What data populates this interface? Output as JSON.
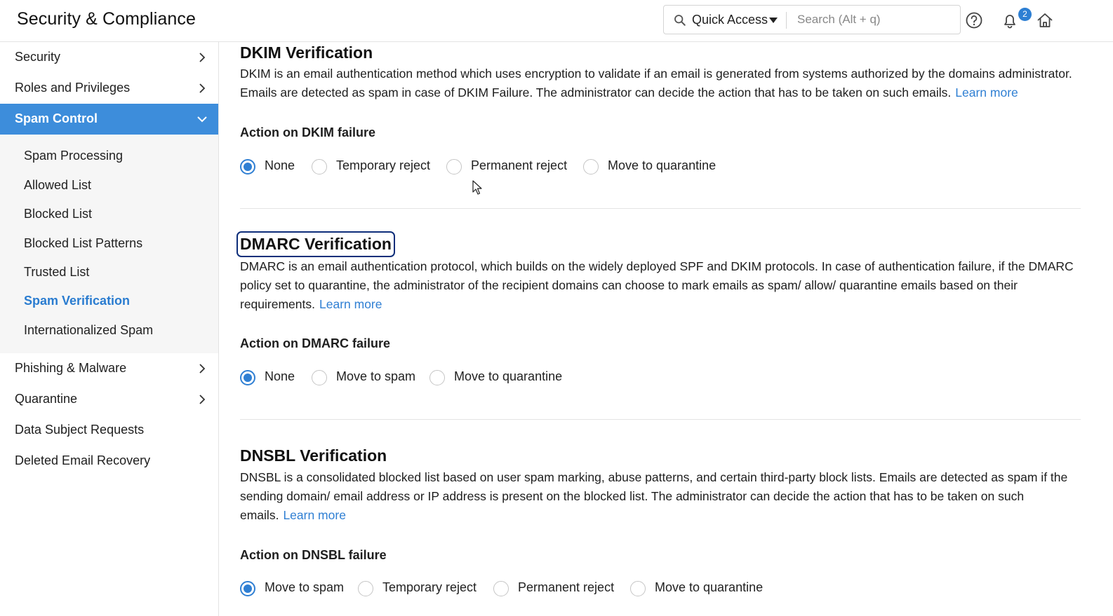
{
  "header": {
    "title": "Security & Compliance",
    "quick_access": "Quick Access",
    "search_placeholder": "Search (Alt + q)",
    "notification_count": "2"
  },
  "sidebar": {
    "items": [
      {
        "label": "Security",
        "chevron": "right"
      },
      {
        "label": "Roles and Privileges",
        "chevron": "right"
      },
      {
        "label": "Spam Control",
        "chevron": "down",
        "active": true
      },
      {
        "label": "Phishing & Malware",
        "chevron": "right"
      },
      {
        "label": "Quarantine",
        "chevron": "right"
      },
      {
        "label": "Data Subject Requests"
      },
      {
        "label": "Deleted Email Recovery"
      }
    ],
    "spam_sub_items": [
      "Spam Processing",
      "Allowed List",
      "Blocked List",
      "Blocked List Patterns",
      "Trusted List",
      "Spam Verification",
      "Internationalized Spam"
    ],
    "active_sub_item": "Spam Verification"
  },
  "sections": [
    {
      "title": "DKIM Verification",
      "description": "DKIM is an email authentication method which uses encryption to validate if an email is generated from systems authorized by the domains administrator. Emails are detected as spam in case of DKIM Failure. The administrator can decide the action that has to be taken on such emails.",
      "learn_more": "Learn more",
      "action_label": "Action on DKIM failure",
      "options": [
        "None",
        "Temporary reject",
        "Permanent reject",
        "Move to quarantine"
      ],
      "selected": "None"
    },
    {
      "title": "DMARC Verification",
      "description": "DMARC is an email authentication protocol, which builds on the widely deployed SPF and DKIM protocols. In case of authentication failure, if the DMARC policy set to quarantine, the administrator of the recipient domains can choose to mark emails as spam/ allow/ quarantine emails based on their requirements.",
      "learn_more": "Learn more",
      "action_label": "Action on DMARC failure",
      "options": [
        "None",
        "Move to spam",
        "Move to quarantine"
      ],
      "selected": "None"
    },
    {
      "title": "DNSBL Verification",
      "description": "DNSBL is a consolidated blocked list based on user spam marking, abuse patterns, and certain third-party block lists. Emails are detected as spam if the sending domain/ email address or IP address is present on the blocked list. The administrator can decide the action that has to be taken on such emails.",
      "learn_more": "Learn more",
      "action_label": "Action on DNSBL failure",
      "options": [
        "Move to spam",
        "Temporary reject",
        "Permanent reject",
        "Move to quarantine"
      ],
      "selected": "Move to spam"
    }
  ],
  "colors": {
    "accent": "#2f7fd3",
    "sidebar_active_bg": "#3d8ddb",
    "focus_outline": "#0e2e7a"
  },
  "icons": {
    "search": "search-icon",
    "help": "help-circle-icon",
    "notifications": "bell-icon",
    "home": "home-icon"
  }
}
